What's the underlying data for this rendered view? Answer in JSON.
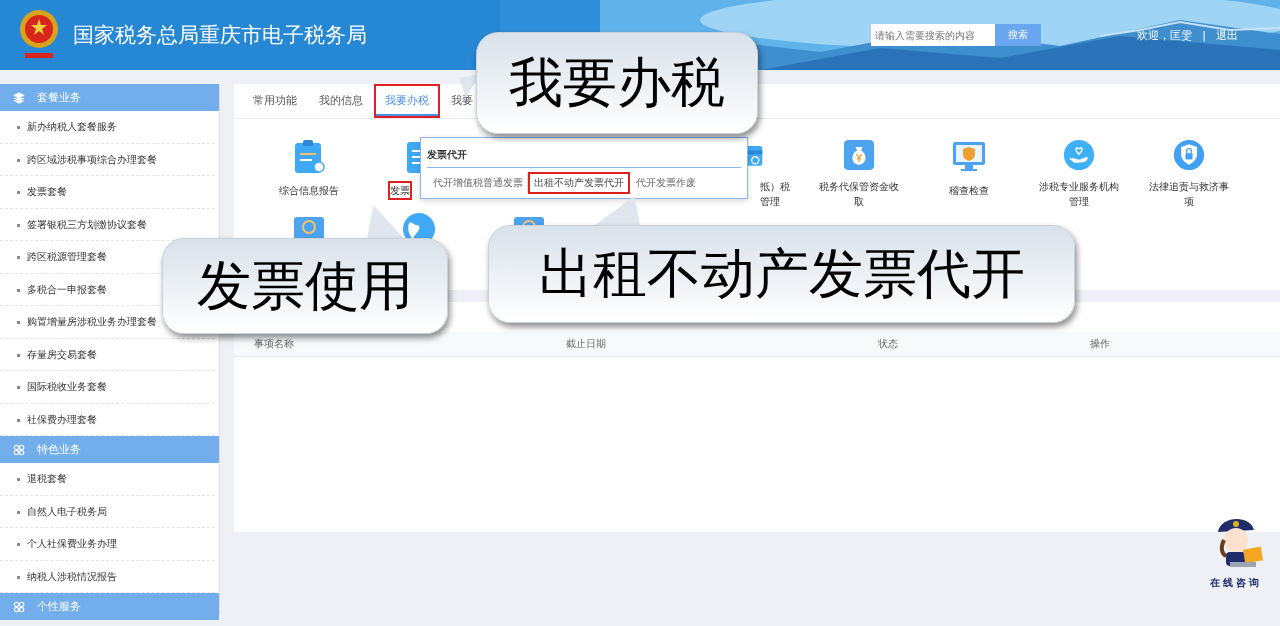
{
  "header": {
    "title": "国家税务总局重庆市电子税务局",
    "search": {
      "placeholder": "请输入需要搜索的内容",
      "button": "搜索"
    },
    "welcome": "欢迎，匡雯",
    "separator": "|",
    "logout": "退出"
  },
  "sidebar": {
    "groups": [
      {
        "title": "套餐业务",
        "kind": "layers",
        "items": [
          "新办纳税人套餐服务",
          "跨区域涉税事项综合办理套餐",
          "发票套餐",
          "签署银税三方划缴协议套餐",
          "跨区税源管理套餐",
          "多税合一申报套餐",
          "购置增量房涉税业务办理套餐",
          "存量房交易套餐",
          "国际税收业务套餐",
          "社保费办理套餐"
        ]
      },
      {
        "title": "特色业务",
        "kind": "clover",
        "items": [
          "退税套餐",
          "自然人电子税务局",
          "个人社保费业务办理",
          "纳税人涉税情况报告"
        ]
      },
      {
        "title": "个性服务",
        "kind": "clover"
      }
    ]
  },
  "tabs": [
    {
      "label": "常用功能",
      "selected": false,
      "highlighted": false
    },
    {
      "label": "我的信息",
      "selected": false,
      "highlighted": false
    },
    {
      "label": "我要办税",
      "selected": true,
      "highlighted": true
    },
    {
      "label": "我要",
      "selected": false,
      "highlighted": false
    }
  ],
  "functions": [
    {
      "label": "综合信息报告",
      "kind": "clipboard",
      "highlighted": false
    },
    {
      "label": "发票",
      "kind": "notepad",
      "highlighted": true
    },
    {
      "label": "抵）税管理",
      "kind": "card",
      "highlighted": false
    },
    {
      "label": "税务代保管资金收取",
      "kind": "moneybag",
      "highlighted": false
    },
    {
      "label": "稽查检查",
      "kind": "monitor",
      "highlighted": false
    },
    {
      "label": "涉税专业服务机构管理",
      "kind": "hands",
      "highlighted": false
    },
    {
      "label": "法律追责与救济事项",
      "kind": "shield",
      "highlighted": false
    },
    {
      "kind": "sscard"
    },
    {
      "kind": "globe"
    },
    {
      "kind": "sscard"
    }
  ],
  "dropdown": {
    "title": "发票代开",
    "items": [
      {
        "label": "代开增值税普通发票",
        "highlighted": false
      },
      {
        "label": "出租不动产发票代开",
        "highlighted": true
      },
      {
        "label": "代开发票作废",
        "highlighted": false
      }
    ]
  },
  "task_table": {
    "columns": [
      "事项名称",
      "截止日期",
      "状态",
      "操作"
    ]
  },
  "callouts": [
    {
      "text": "我要办税"
    },
    {
      "text": "发票使用"
    },
    {
      "text": "出租不动产发票代开"
    }
  ],
  "assistant": {
    "label": "在线咨询"
  }
}
